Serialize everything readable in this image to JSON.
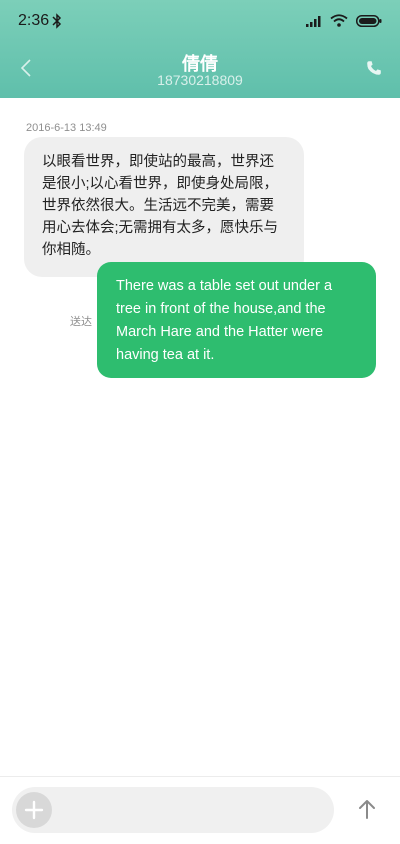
{
  "status_bar": {
    "time": "2:36",
    "icons": [
      "bluetooth-icon",
      "signal-icon",
      "wifi-icon",
      "battery-icon"
    ]
  },
  "header": {
    "contact_name": "倩倩",
    "contact_number": "18730218809",
    "icons": [
      "back-icon",
      "phone-icon"
    ],
    "gradient_top": "#7ccfb9",
    "gradient_bottom": "#5fbfab"
  },
  "conversation": {
    "timestamp": "2016-6-13 13:49",
    "received_message": "以眼看世界，即使站的最高，世界还是很小;以心看世界，即使身处局限，世界依然很大。生活远不完美，需要用心去体会;无需拥有太多，愿快乐与你相随。",
    "sent_status": "送达",
    "sent_message": "There was a table set out under a tree in front of the house,and the March Hare and the Hatter were having tea at it.",
    "received_bubble_color": "#efefef",
    "sent_bubble_color": "#2ebd6f"
  },
  "composer": {
    "placeholder": "",
    "value": "",
    "icons": [
      "plus-icon",
      "send-arrow-icon"
    ]
  }
}
